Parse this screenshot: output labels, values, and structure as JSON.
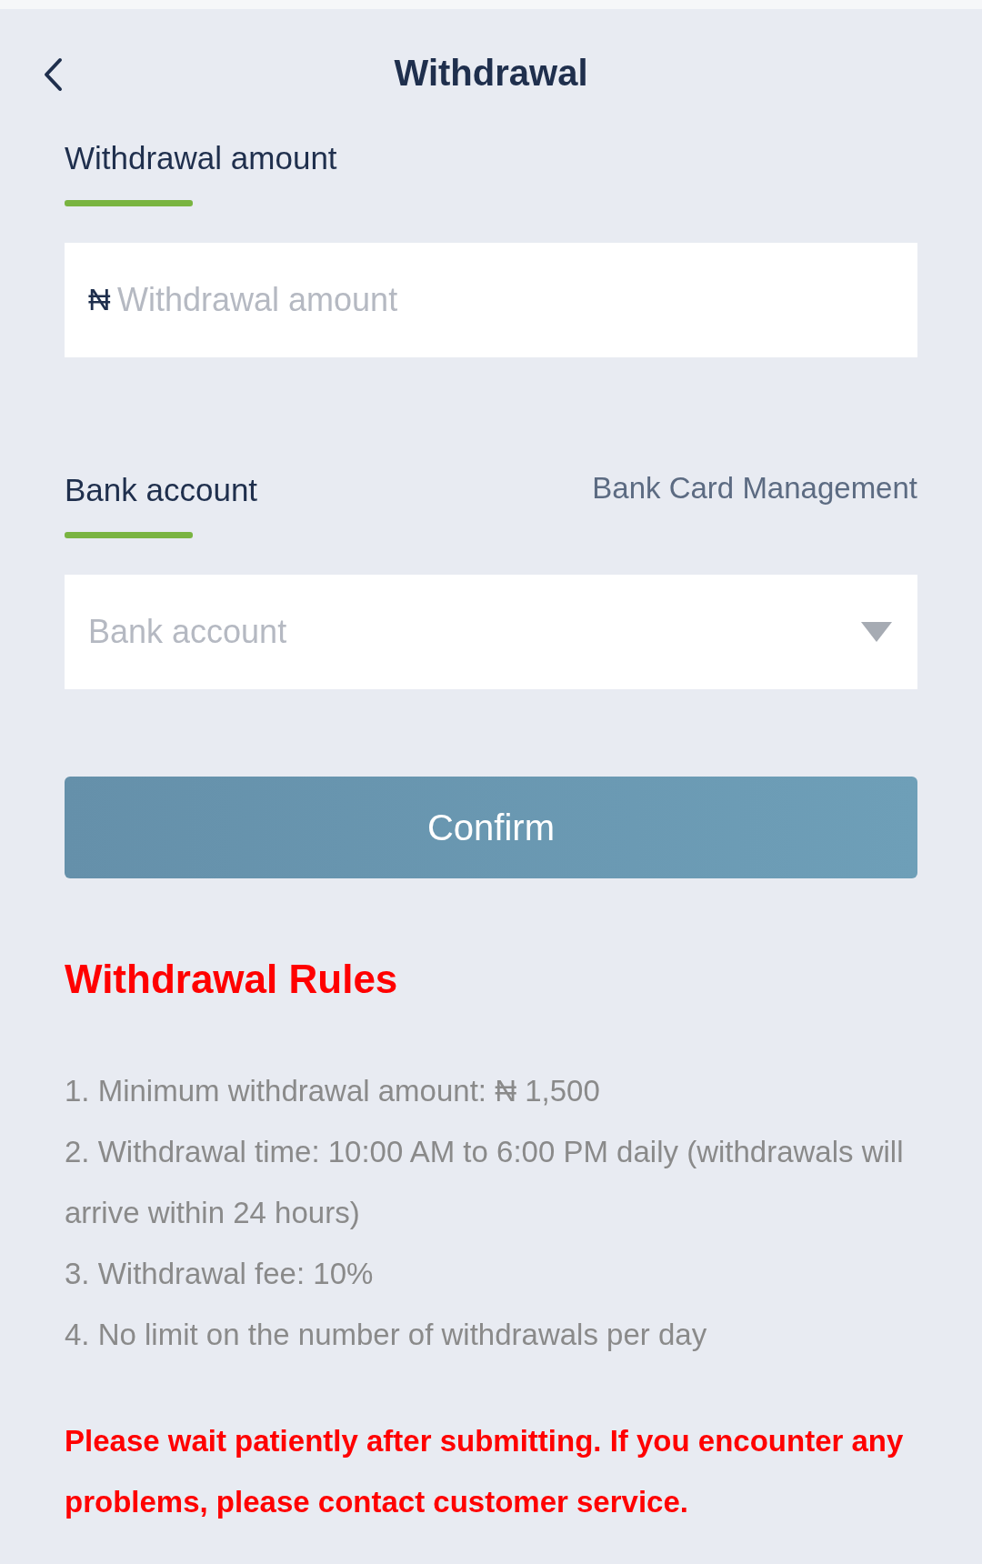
{
  "header": {
    "title": "Withdrawal"
  },
  "amount": {
    "label": "Withdrawal amount",
    "currency": "₦",
    "placeholder": "Withdrawal amount"
  },
  "bank": {
    "label": "Bank account",
    "link": "Bank Card Management",
    "placeholder": "Bank account"
  },
  "confirm": "Confirm",
  "rules": {
    "title": "Withdrawal Rules",
    "items": [
      "1. Minimum withdrawal amount: ₦ 1,500",
      "2. Withdrawal time: 10:00 AM to 6:00 PM daily (withdrawals will arrive within 24 hours)",
      "3. Withdrawal fee: 10%",
      "4. No limit on the number of withdrawals per day"
    ]
  },
  "notice": "Please wait patiently after submitting. If you encounter any problems, please contact customer service."
}
